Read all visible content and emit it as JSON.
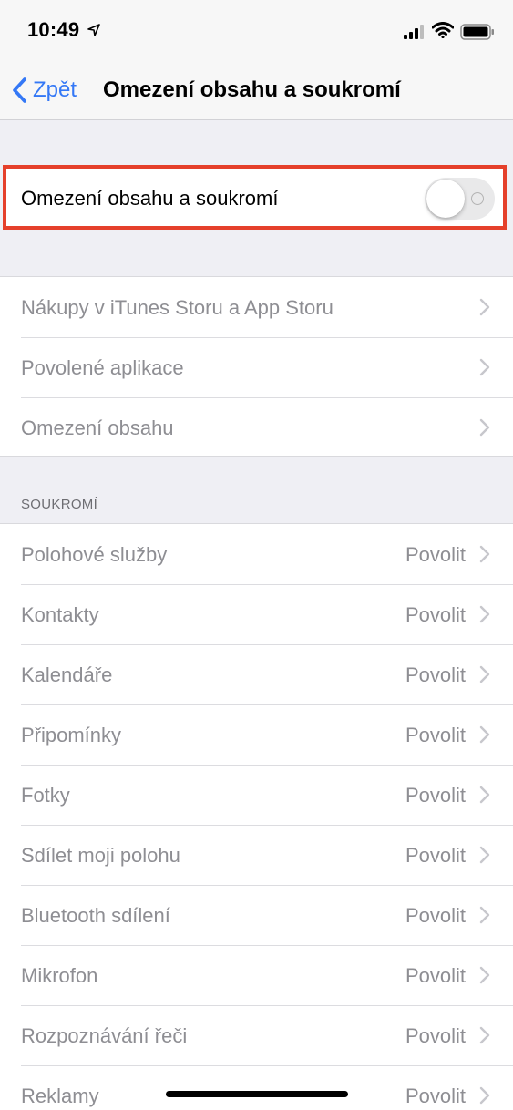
{
  "status_bar": {
    "time": "10:49",
    "icons": [
      "location-arrow-icon",
      "cellular-signal-icon",
      "wifi-icon",
      "battery-icon"
    ]
  },
  "nav": {
    "back_label": "Zpět",
    "title": "Omezení obsahu a soukromí"
  },
  "master_toggle": {
    "label": "Omezení obsahu a soukromí",
    "state": "off"
  },
  "group1": {
    "items": [
      {
        "label": "Nákupy v iTunes Storu a App Storu"
      },
      {
        "label": "Povolené aplikace"
      },
      {
        "label": "Omezení obsahu"
      }
    ]
  },
  "privacy": {
    "header": "SOUKROMÍ",
    "items": [
      {
        "label": "Polohové služby",
        "value": "Povolit"
      },
      {
        "label": "Kontakty",
        "value": "Povolit"
      },
      {
        "label": "Kalendáře",
        "value": "Povolit"
      },
      {
        "label": "Připomínky",
        "value": "Povolit"
      },
      {
        "label": "Fotky",
        "value": "Povolit"
      },
      {
        "label": "Sdílet moji polohu",
        "value": "Povolit"
      },
      {
        "label": "Bluetooth sdílení",
        "value": "Povolit"
      },
      {
        "label": "Mikrofon",
        "value": "Povolit"
      },
      {
        "label": "Rozpoznávání řeči",
        "value": "Povolit"
      },
      {
        "label": "Reklamy",
        "value": "Povolit"
      }
    ]
  },
  "colors": {
    "accent": "#3478f6",
    "highlight_frame": "#e5402b",
    "disabled_text": "#8e8e93",
    "background": "#efeff4"
  }
}
